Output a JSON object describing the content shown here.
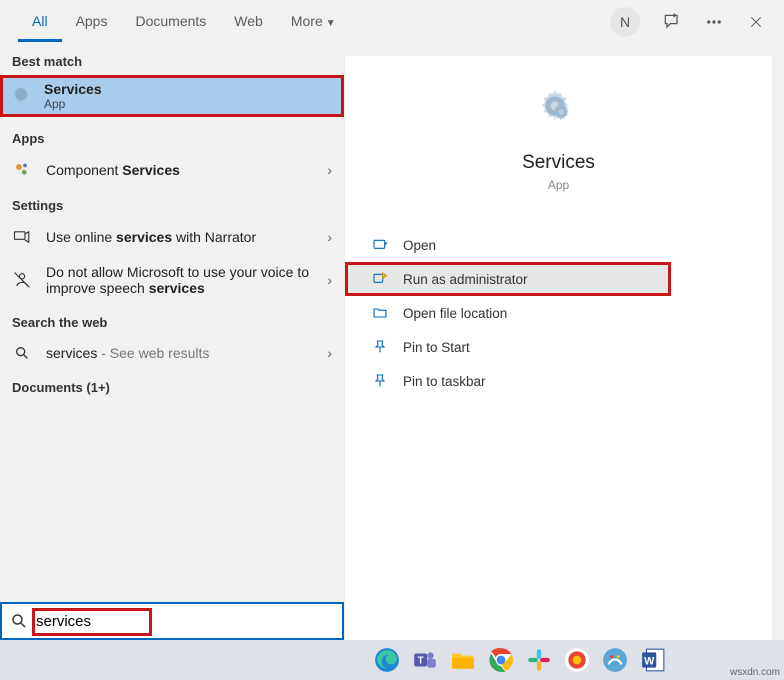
{
  "tabs": {
    "all": "All",
    "apps": "Apps",
    "documents": "Documents",
    "web": "Web",
    "more": "More"
  },
  "avatar_initial": "N",
  "left": {
    "best_match_hdr": "Best match",
    "best_match": {
      "title": "Services",
      "sub": "App"
    },
    "apps_hdr": "Apps",
    "app_item_prefix": "Component ",
    "app_item_bold": "Services",
    "settings_hdr": "Settings",
    "setting1_a": "Use online ",
    "setting1_b": "services",
    "setting1_c": " with Narrator",
    "setting2_a": "Do not allow Microsoft to use your voice to improve speech ",
    "setting2_b": "services",
    "web_hdr": "Search the web",
    "web_item_a": "services",
    "web_item_b": " - See web results",
    "docs_hdr": "Documents (1+)"
  },
  "preview": {
    "title": "Services",
    "sub": "App",
    "actions": {
      "open": "Open",
      "run_admin": "Run as administrator",
      "open_loc": "Open file location",
      "pin_start": "Pin to Start",
      "pin_taskbar": "Pin to taskbar"
    }
  },
  "search_value": "services",
  "watermark": "wsxdn.com"
}
